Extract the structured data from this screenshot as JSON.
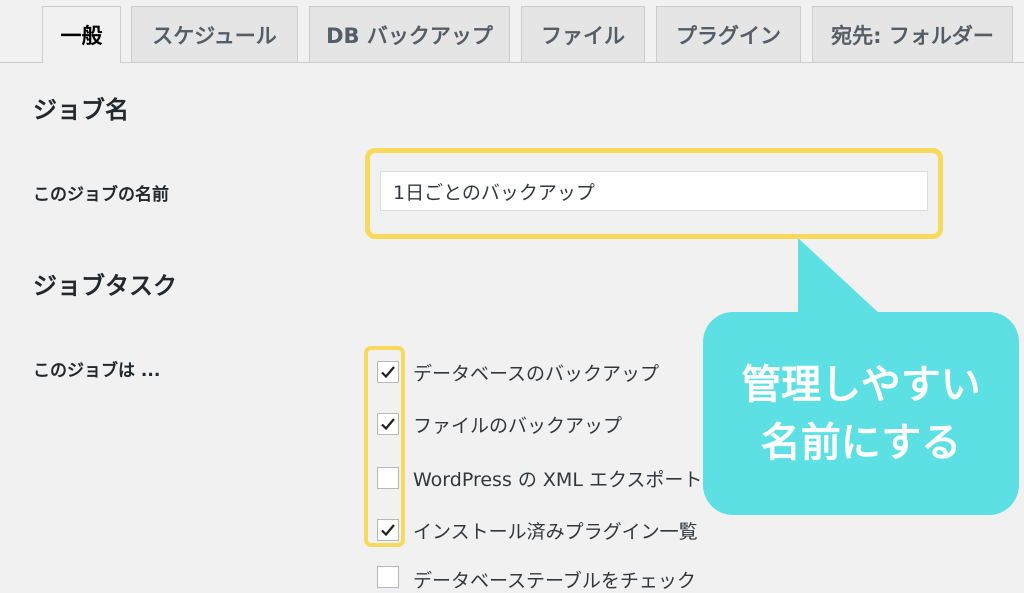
{
  "tabs": [
    {
      "label": "一般",
      "active": true
    },
    {
      "label": "スケジュール",
      "active": false
    },
    {
      "label": "DB バックアップ",
      "active": false
    },
    {
      "label": "ファイル",
      "active": false
    },
    {
      "label": "プラグイン",
      "active": false
    },
    {
      "label": "宛先: フォルダー",
      "active": false
    }
  ],
  "job_name": {
    "heading": "ジョブ名",
    "label": "このジョブの名前",
    "value": "1日ごとのバックアップ"
  },
  "job_tasks": {
    "heading": "ジョブタスク",
    "label": "このジョブは ...",
    "items": [
      {
        "label": "データベースのバックアップ",
        "checked": true
      },
      {
        "label": "ファイルのバックアップ",
        "checked": true
      },
      {
        "label": "WordPress の XML エクスポート",
        "checked": false
      },
      {
        "label": "インストール済みプラグイン一覧",
        "checked": true
      },
      {
        "label": "データベーステーブルをチェック",
        "checked": false
      }
    ]
  },
  "callout": {
    "line1": "管理しやすい",
    "line2": "名前にする"
  },
  "colors": {
    "highlight": "#f8d95c",
    "callout": "#5ce0e4",
    "background": "#f1f1f1"
  }
}
